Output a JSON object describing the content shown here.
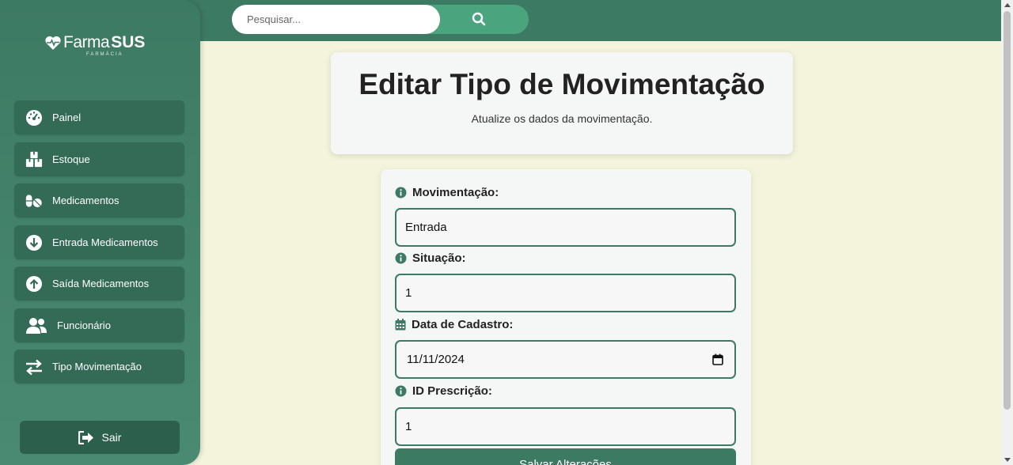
{
  "search": {
    "placeholder": "Pesquisar..."
  },
  "brand": {
    "name_light": "Farma",
    "name_bold": "SUS",
    "subtitle": "FARMÁCIA"
  },
  "sidebar": {
    "items": [
      {
        "label": "Painel",
        "icon": "gauge-icon"
      },
      {
        "label": "Estoque",
        "icon": "boxes-icon"
      },
      {
        "label": "Medicamentos",
        "icon": "pills-icon"
      },
      {
        "label": "Entrada Medicamentos",
        "icon": "arrow-down-circle-icon"
      },
      {
        "label": "Saída Medicamentos",
        "icon": "arrow-up-circle-icon"
      },
      {
        "label": "Funcionário",
        "icon": "users-icon"
      },
      {
        "label": "Tipo Movimentação",
        "icon": "swap-arrows-icon"
      }
    ],
    "logout_label": "Sair"
  },
  "header": {
    "title": "Editar Tipo de Movimentação",
    "subtitle": "Atualize os dados da movimentação."
  },
  "form": {
    "fields": [
      {
        "label": "Movimentação:",
        "value": "Entrada",
        "icon": "info-icon"
      },
      {
        "label": "Situação:",
        "value": "1",
        "icon": "info-icon"
      },
      {
        "label": "Data de Cadastro:",
        "value": "11/11/2024",
        "icon": "calendar-icon"
      },
      {
        "label": "ID Prescrição:",
        "value": "1",
        "icon": "info-icon"
      }
    ],
    "submit_label": "Salvar Alterações"
  },
  "colors": {
    "primary": "#3d7a63",
    "accent": "#4aa57f",
    "background": "#f4f4dc",
    "card": "#f5f7f6"
  }
}
